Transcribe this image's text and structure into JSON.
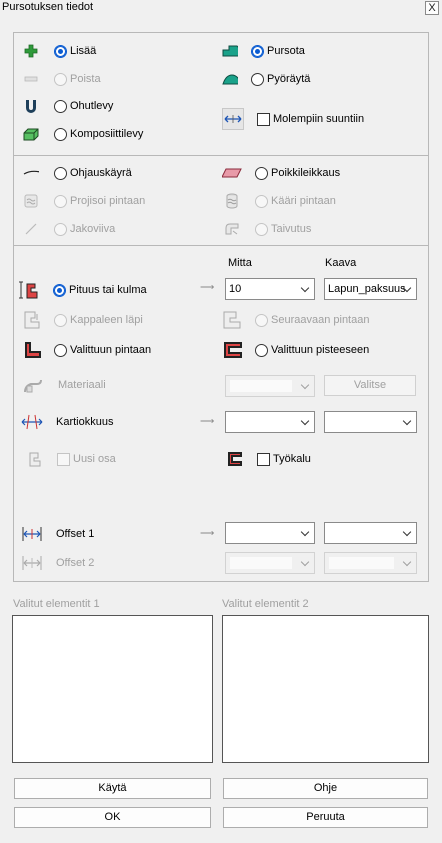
{
  "window": {
    "title": "Pursotuksen tiedot",
    "close_label": "X"
  },
  "ops": {
    "add": "Lisää",
    "remove": "Poista",
    "thin": "Ohutlevy",
    "composite": "Komposiittilevy",
    "extrude": "Pursota",
    "revolve": "Pyöräytä",
    "both_directions": "Molempiin suuntiin"
  },
  "path": {
    "guide_curve": "Ohjauskäyrä",
    "project": "Projisoi pintaan",
    "split_line": "Jakoviiva",
    "cross_section": "Poikkileikkaus",
    "wrap": "Kääri pintaan",
    "bend": "Taivutus"
  },
  "extent": {
    "col_measure": "Mitta",
    "col_formula": "Kaava",
    "length_or_angle": "Pituus tai kulma",
    "through_part": "Kappaleen läpi",
    "to_selected_face": "Valittuun pintaan",
    "to_next_face": "Seuraavaan pintaan",
    "to_selected_point": "Valittuun pisteeseen",
    "measure_value": "10",
    "formula_value": "Lapun_paksuus",
    "material": "Materiaali",
    "select_btn": "Valitse",
    "draft": "Kartiokkuus",
    "new_part": "Uusi osa",
    "tool": "Työkalu",
    "offset1": "Offset 1",
    "offset2": "Offset 2"
  },
  "lists": {
    "left_label": "Valitut elementit 1",
    "right_label": "Valitut elementit 2"
  },
  "buttons": {
    "apply": "Käytä",
    "help": "Ohje",
    "ok": "OK",
    "cancel": "Peruuta"
  },
  "state": {
    "operation": "Lisää",
    "method": "Pursota",
    "extent": "Pituus tai kulma",
    "both_directions_checked": false,
    "new_part_checked": false,
    "tool_checked": false
  },
  "colors": {
    "accent_radio": "#0a5bd1",
    "icon_green": "#2e9a3a",
    "icon_teal": "#1aa28a"
  },
  "icons": [
    "plus-icon",
    "minus-icon",
    "magnet-icon",
    "composite-icon",
    "extrude-icon",
    "revolve-icon",
    "double-arrow-icon",
    "curve-icon",
    "parallelogram-icon",
    "surface-icon",
    "wrap-icon",
    "line-icon",
    "bend-icon",
    "length-icon",
    "through-icon",
    "to-face-icon",
    "next-face-icon",
    "to-point-icon",
    "material-icon",
    "draft-icon",
    "new-part-icon",
    "tool-icon",
    "offset-icon"
  ]
}
